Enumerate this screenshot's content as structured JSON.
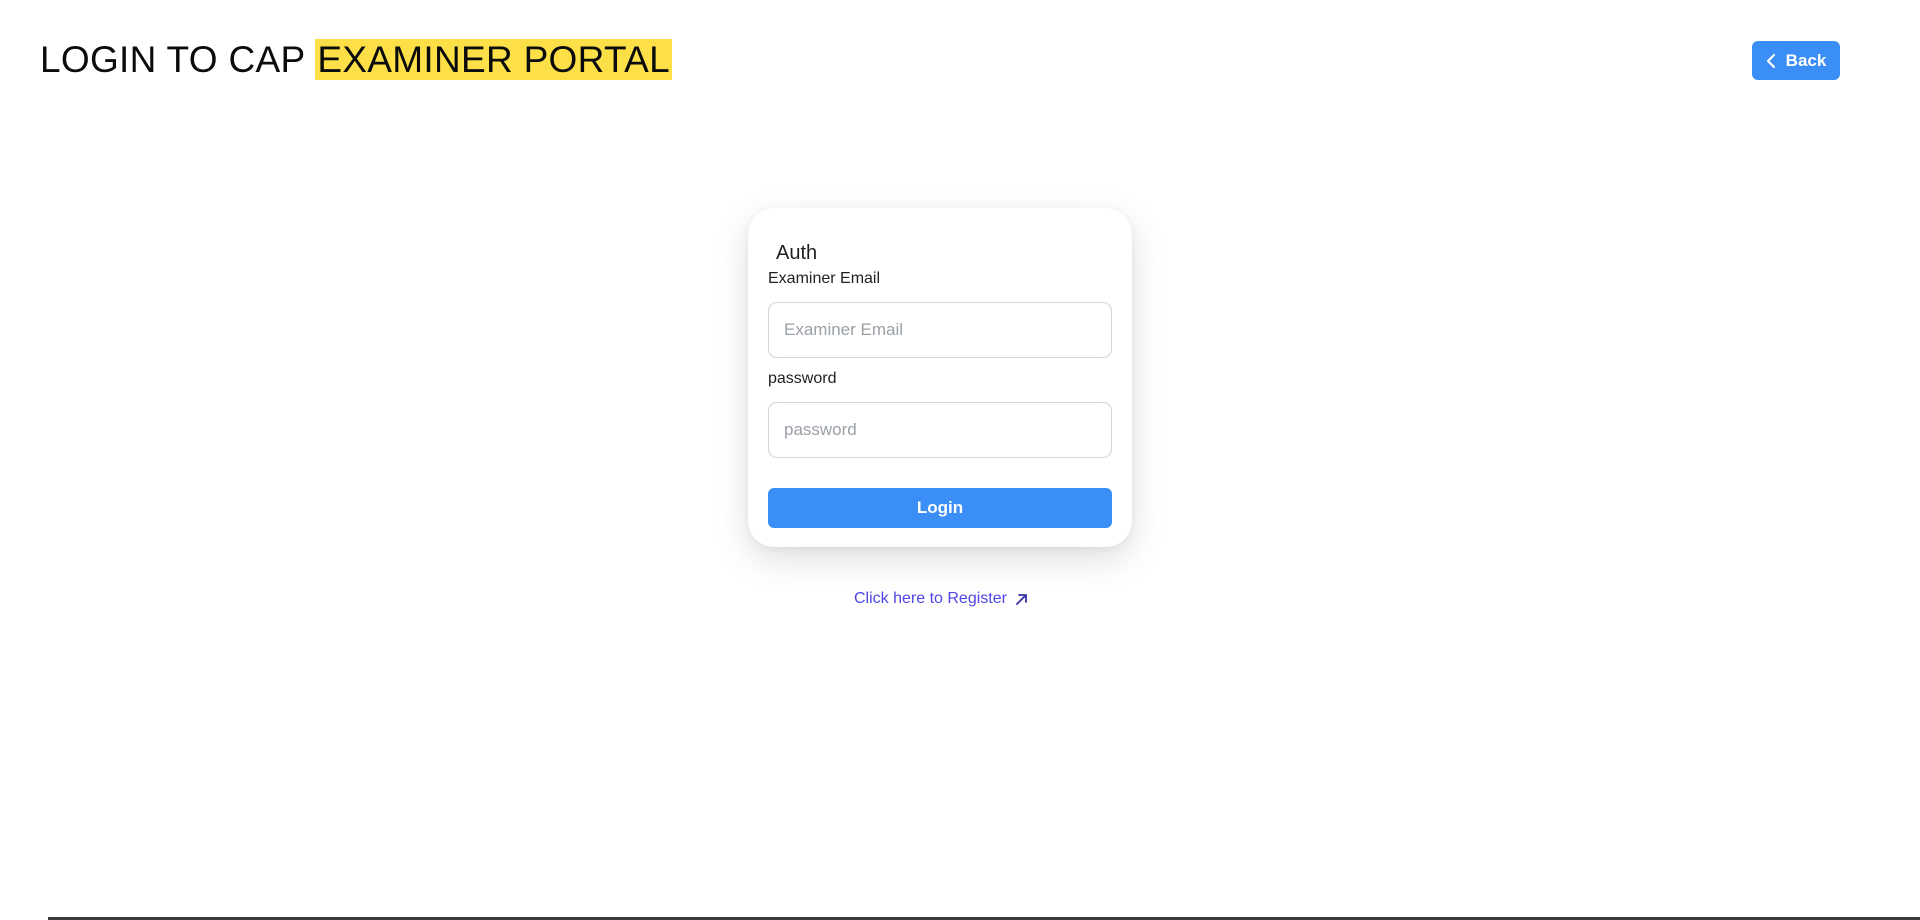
{
  "header": {
    "title_prefix": "LOGIN TO CAP",
    "title_highlight": "EXAMINER PORTAL",
    "back_label": "Back"
  },
  "auth_card": {
    "title": "Auth",
    "email_label": "Examiner Email",
    "email_placeholder": "Examiner Email",
    "password_label": "password",
    "password_placeholder": "password",
    "login_label": "Login"
  },
  "register_link": {
    "label": "Click here to Register"
  },
  "icons": {
    "back": "chevron-left-icon",
    "register": "arrow-up-right-icon"
  },
  "colors": {
    "accent": "#3b8ef5",
    "highlight": "#fde047",
    "link": "#4f46e5"
  }
}
